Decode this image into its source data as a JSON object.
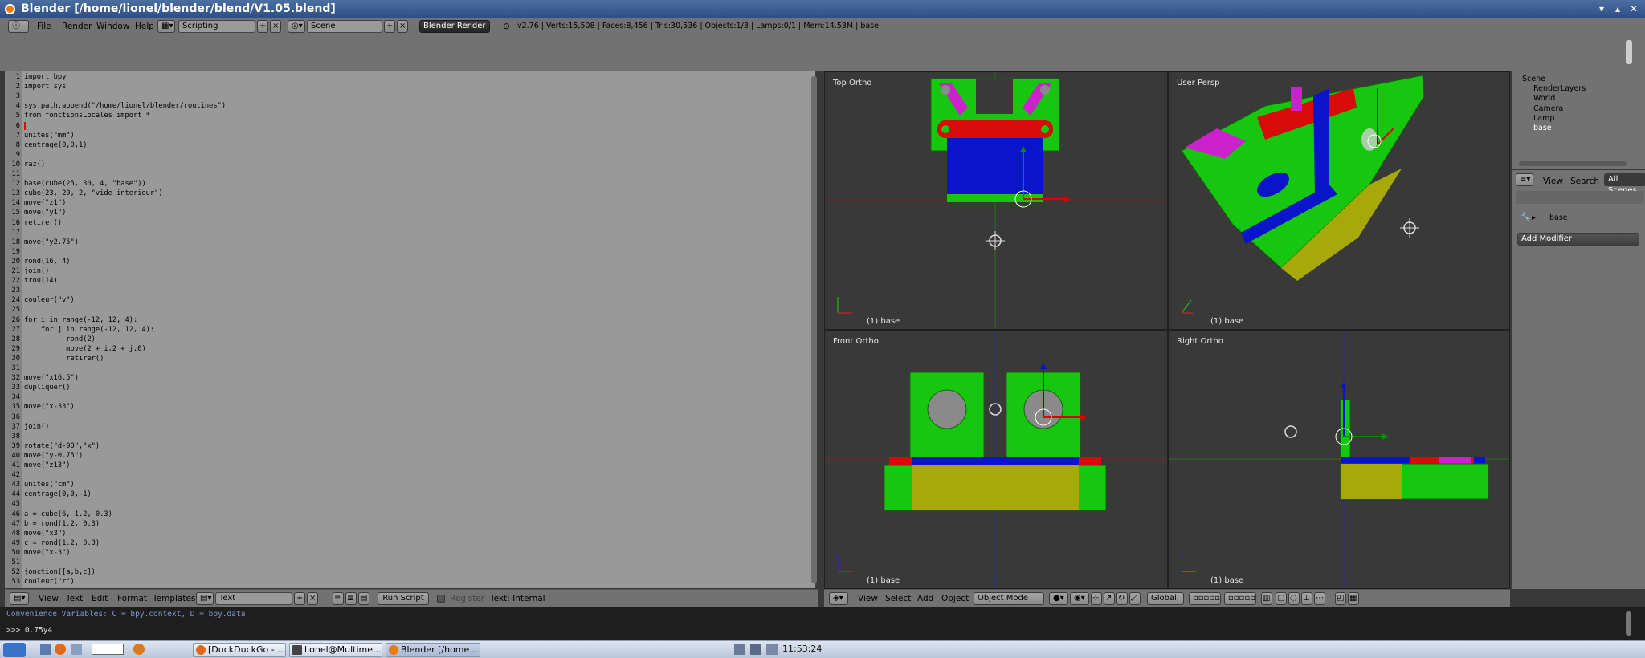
{
  "window": {
    "title": "Blender [/home/lionel/blender/blend/V1.05.blend]"
  },
  "menu": {
    "items": [
      "File",
      "Render",
      "Window",
      "Help"
    ]
  },
  "header": {
    "layout": "Scripting",
    "scene": "Scene",
    "engine": "Blender Render",
    "stats": "v2.76 | Verts:15,508 | Faces:8,456 | Tris:30,536 | Objects:1/3 | Lamps:0/1 | Mem:14.53M | base"
  },
  "code": [
    {
      "n": "1",
      "t": "import bpy"
    },
    {
      "n": "2",
      "t": "import sys"
    },
    {
      "n": "3",
      "t": ""
    },
    {
      "n": "4",
      "t": "sys.path.append(\"/home/lionel/blender/routines\")"
    },
    {
      "n": "5",
      "t": "from fonctionsLocales import *"
    },
    {
      "n": "6",
      "t": ""
    },
    {
      "n": "7",
      "t": "unites(\"mm\")"
    },
    {
      "n": "8",
      "t": "centrage(0,0,1)"
    },
    {
      "n": "9",
      "t": ""
    },
    {
      "n": "10",
      "t": "raz()"
    },
    {
      "n": "11",
      "t": ""
    },
    {
      "n": "12",
      "t": "base(cube(25, 30, 4, \"base\"))"
    },
    {
      "n": "13",
      "t": "cube(23, 29, 2, \"vide interieur\")"
    },
    {
      "n": "14",
      "t": "move(\"z1\")"
    },
    {
      "n": "15",
      "t": "move(\"y1\")"
    },
    {
      "n": "16",
      "t": "retirer()"
    },
    {
      "n": "17",
      "t": ""
    },
    {
      "n": "18",
      "t": "move(\"y2.75\")"
    },
    {
      "n": "19",
      "t": ""
    },
    {
      "n": "20",
      "t": "rond(16, 4)"
    },
    {
      "n": "21",
      "t": "join()"
    },
    {
      "n": "22",
      "t": "trou(14)"
    },
    {
      "n": "23",
      "t": ""
    },
    {
      "n": "24",
      "t": "couleur(\"v\")"
    },
    {
      "n": "25",
      "t": ""
    },
    {
      "n": "26",
      "t": "for i in range(-12, 12, 4):"
    },
    {
      "n": "27",
      "t": "    for j in range(-12, 12, 4):"
    },
    {
      "n": "28",
      "t": "          rond(2)"
    },
    {
      "n": "29",
      "t": "          move(2 + i,2 + j,0)"
    },
    {
      "n": "30",
      "t": "          retirer()"
    },
    {
      "n": "31",
      "t": ""
    },
    {
      "n": "32",
      "t": "move(\"x16.5\")"
    },
    {
      "n": "33",
      "t": "dupliquer()"
    },
    {
      "n": "34",
      "t": ""
    },
    {
      "n": "35",
      "t": "move(\"x-33\")"
    },
    {
      "n": "36",
      "t": ""
    },
    {
      "n": "37",
      "t": "join()"
    },
    {
      "n": "38",
      "t": ""
    },
    {
      "n": "39",
      "t": "rotate(\"d-90\",\"x\")"
    },
    {
      "n": "40",
      "t": "move(\"y-0.75\")"
    },
    {
      "n": "41",
      "t": "move(\"z13\")"
    },
    {
      "n": "42",
      "t": ""
    },
    {
      "n": "43",
      "t": "unites(\"cm\")"
    },
    {
      "n": "44",
      "t": "centrage(0,0,-1)"
    },
    {
      "n": "45",
      "t": ""
    },
    {
      "n": "46",
      "t": "a = cube(6, 1.2, 0.3)"
    },
    {
      "n": "47",
      "t": "b = rond(1.2, 0.3)"
    },
    {
      "n": "48",
      "t": "move(\"x3\")"
    },
    {
      "n": "49",
      "t": "c = rond(1.2, 0.3)"
    },
    {
      "n": "50",
      "t": "move(\"x-3\")"
    },
    {
      "n": "51",
      "t": ""
    },
    {
      "n": "52",
      "t": "jonction([a,b,c])"
    },
    {
      "n": "53",
      "t": "couleur(\"r\")"
    }
  ],
  "text_editor": {
    "menus": [
      "View",
      "Text",
      "Edit",
      "Format",
      "Templates"
    ],
    "datablock": "Text",
    "run_script": "Run Script",
    "register": "Register",
    "status": "Text: Internal"
  },
  "viewports": {
    "top": {
      "label": "Top Ortho",
      "obj": "(1) base"
    },
    "persp": {
      "label": "User Persp",
      "obj": "(1) base"
    },
    "front": {
      "label": "Front Ortho",
      "obj": "(1) base"
    },
    "right": {
      "label": "Right Ortho",
      "obj": "(1) base"
    }
  },
  "view3d_header": {
    "menus": [
      "View",
      "Select",
      "Add",
      "Object"
    ],
    "mode": "Object Mode",
    "orientation": "Global"
  },
  "outliner": {
    "items": [
      "Scene",
      "RenderLayers",
      "World",
      "Camera",
      "Lamp",
      "base"
    ]
  },
  "properties": {
    "tabs": [
      "View",
      "Search",
      "All Scenes"
    ],
    "object": "base",
    "add_modifier": "Add Modifier"
  },
  "console": {
    "line1": "Convenience Variables: C = bpy.context, D = bpy.data",
    "line2": ">>> 0.75y4"
  },
  "taskbar": {
    "tasks": [
      "[DuckDuckGo - ...",
      "lionel@Multime...",
      "Blender [/home..."
    ],
    "clock": "11:53:24"
  },
  "colors": {
    "green": "#17c70f",
    "blue": "#0a14c8",
    "red": "#d80a0a",
    "magenta": "#cc22cc",
    "yellow": "#a8a80a"
  }
}
